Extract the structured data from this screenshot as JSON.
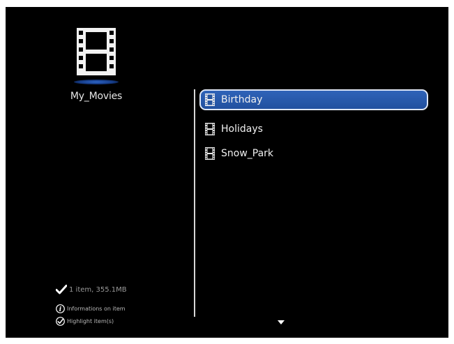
{
  "folder": {
    "name": "My_Movies",
    "icon": "film-icon"
  },
  "list": {
    "items": [
      {
        "label": "Birthday",
        "icon": "film-icon",
        "selected": true
      },
      {
        "label": "Holidays",
        "icon": "film-icon",
        "selected": false
      },
      {
        "label": "Snow_Park",
        "icon": "film-icon",
        "selected": false
      }
    ]
  },
  "footer": {
    "status": "1 item, 355.1MB",
    "info_hint": "Informations on item",
    "highlight_hint": "Highlight item(s)"
  },
  "colors": {
    "background": "#000000",
    "selection": "#2a5cad",
    "text": "#f0f0f0"
  }
}
